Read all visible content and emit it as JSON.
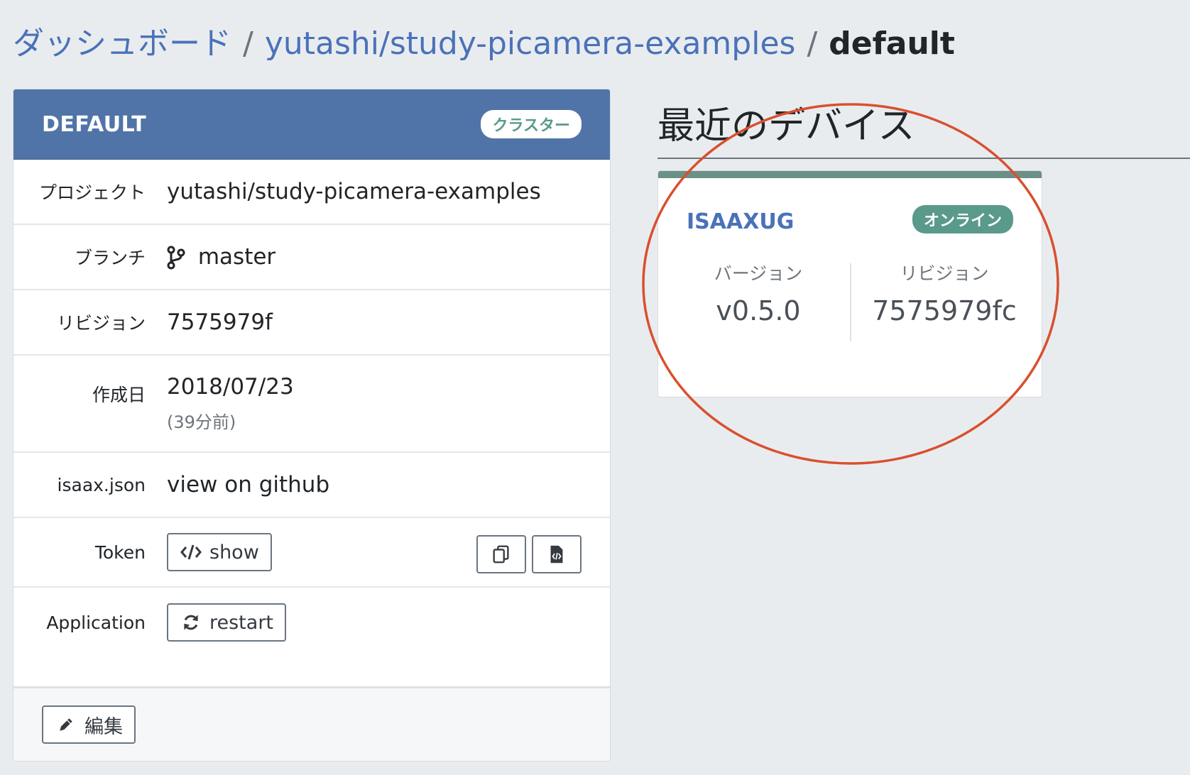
{
  "breadcrumb": {
    "dashboard": "ダッシュボード",
    "project": "yutashi/study-picamera-examples",
    "current": "default",
    "separator": "/"
  },
  "cluster": {
    "title": "DEFAULT",
    "badge": "クラスター",
    "rows": {
      "project": {
        "label": "プロジェクト",
        "value": "yutashi/study-picamera-examples"
      },
      "branch": {
        "label": "ブランチ",
        "value": "master",
        "icon": "git-branch-icon"
      },
      "revision": {
        "label": "リビジョン",
        "value": "7575979f"
      },
      "created": {
        "label": "作成日",
        "value": "2018/07/23",
        "relative": "(39分前)"
      },
      "config": {
        "label": "isaax.json",
        "value": "view on github"
      },
      "token": {
        "label": "Token",
        "button": "show",
        "icons": [
          "copy-icon",
          "file-code-icon"
        ]
      },
      "application": {
        "label": "Application",
        "button": "restart",
        "icon": "refresh-icon"
      }
    },
    "edit_button": "編集"
  },
  "recent_devices": {
    "title": "最近のデバイス",
    "device": {
      "name": "ISAAXUG",
      "status": "オンライン",
      "version_label": "バージョン",
      "version": "v0.5.0",
      "revision_label": "リビジョン",
      "revision": "7575979fc"
    }
  },
  "colors": {
    "link": "#4a72b8",
    "header": "#5174a8",
    "online": "#5a9a8c",
    "annotation": "#d9502e"
  }
}
